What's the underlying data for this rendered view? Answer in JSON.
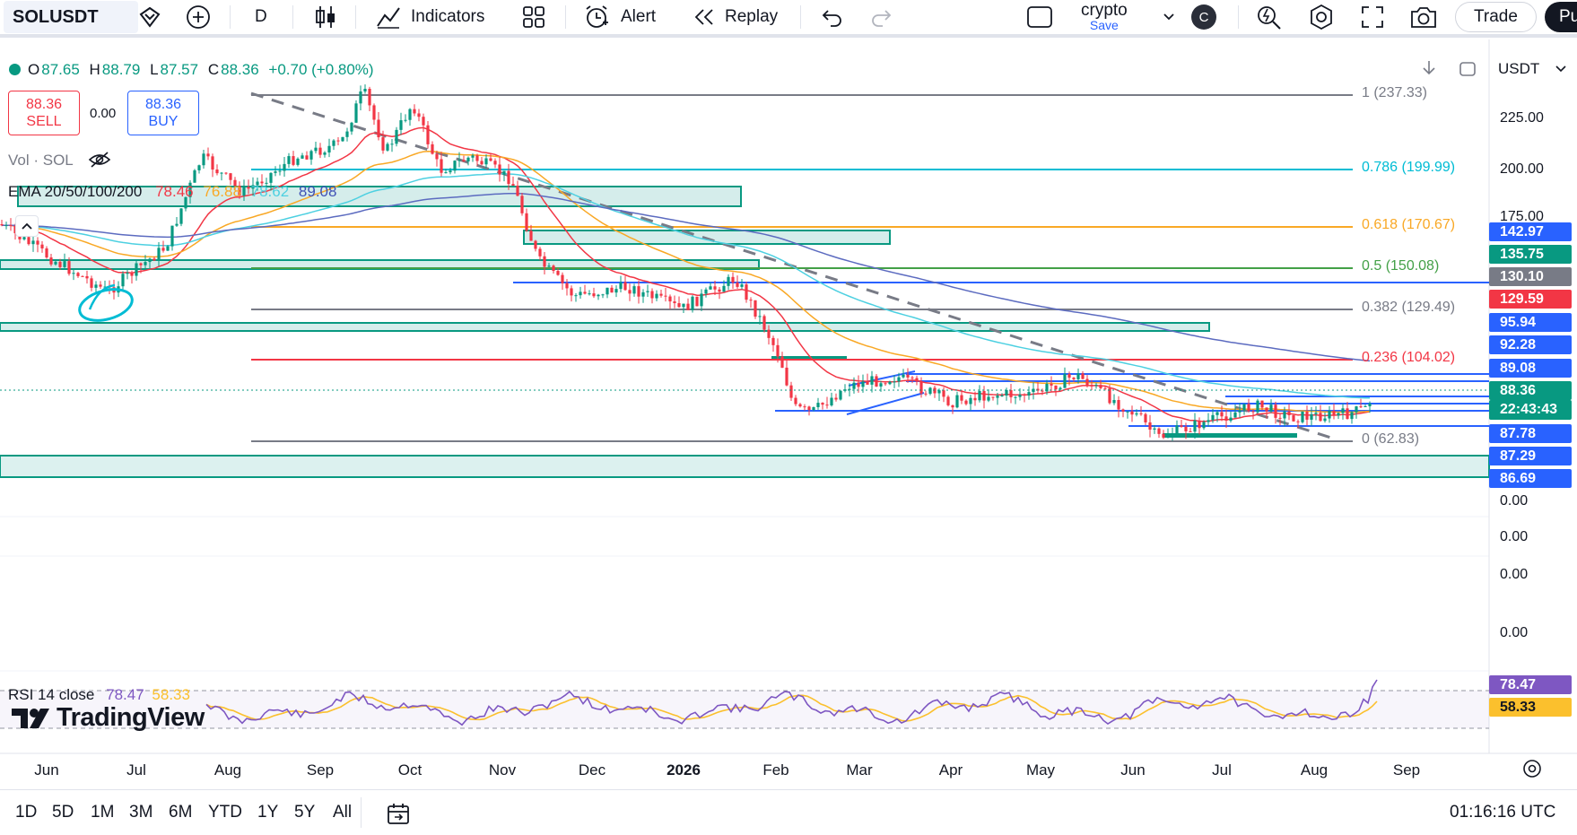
{
  "toolbar": {
    "symbol": "SOLUSDT",
    "interval": "D",
    "indicators_label": "Indicators",
    "alert_label": "Alert",
    "replay_label": "Replay",
    "layout_name": "crypto",
    "layout_save": "Save",
    "avatar_letter": "C",
    "trade_label": "Trade",
    "publish_label": "Pu"
  },
  "legend": {
    "open_label": "O",
    "open": "87.65",
    "high_label": "H",
    "high": "88.79",
    "low_label": "L",
    "low": "87.57",
    "close_label": "C",
    "close": "88.36",
    "change": "+0.70 (+0.80%)",
    "sell_price": "88.36",
    "sell_label": "SELL",
    "spread": "0.00",
    "buy_price": "88.36",
    "buy_label": "BUY",
    "vol_label": "Vol · SOL",
    "ema_label": "EMA 20/50/100/200",
    "ema_values": [
      "78.46",
      "76.88",
      "78.62",
      "89.08"
    ],
    "rsi_label": "RSI 14 close",
    "rsi_values": [
      "78.47",
      "58.33"
    ]
  },
  "currency": "USDT",
  "fib_levels": [
    {
      "label": "1 (237.33)",
      "color": "#787b86"
    },
    {
      "label": "0.786 (199.99)",
      "color": "#00bcd4"
    },
    {
      "label": "0.618 (170.67)",
      "color": "#f9a825"
    },
    {
      "label": "0.5 (150.08)",
      "color": "#43a047"
    },
    {
      "label": "0.382 (129.49)",
      "color": "#787b86"
    },
    {
      "label": "0.236 (104.02)",
      "color": "#f23645"
    },
    {
      "label": "0 (62.83)",
      "color": "#787b86"
    }
  ],
  "price_ticks": [
    "225.00",
    "200.00",
    "175.00"
  ],
  "indicator_ticks": [
    "0.00",
    "0.00",
    "0.00",
    "0.00"
  ],
  "price_labels": [
    {
      "text": "142.97",
      "color": "#2962ff"
    },
    {
      "text": "135.75",
      "color": "#089981"
    },
    {
      "text": "130.10",
      "color": "#787b86"
    },
    {
      "text": "129.59",
      "color": "#f23645"
    },
    {
      "text": "95.94",
      "color": "#2962ff"
    },
    {
      "text": "92.28",
      "color": "#2962ff"
    },
    {
      "text": "89.08",
      "color": "#2962ff"
    },
    {
      "text": "88.36",
      "color": "#089981"
    },
    {
      "text": "22:43:43",
      "color": "#089981"
    },
    {
      "text": "87.78",
      "color": "#2962ff"
    },
    {
      "text": "87.29",
      "color": "#2962ff"
    },
    {
      "text": "86.69",
      "color": "#2962ff"
    }
  ],
  "rsi_axis_labels": [
    {
      "text": "78.47",
      "color": "#7e57c2"
    },
    {
      "text": "58.33",
      "color": "#fbc02d"
    }
  ],
  "time_ticks": [
    "Jun",
    "Jul",
    "Aug",
    "Sep",
    "Oct",
    "Nov",
    "Dec",
    "2026",
    "Feb",
    "Mar",
    "Apr",
    "May",
    "Jun",
    "Jul",
    "Aug",
    "Sep"
  ],
  "ranges": [
    "1D",
    "5D",
    "1M",
    "3M",
    "6M",
    "YTD",
    "1Y",
    "5Y",
    "All"
  ],
  "clock": "01:16:16 UTC",
  "brand": "TradingView",
  "colors": {
    "up": "#089981",
    "down": "#f23645",
    "ema20": "#f23645",
    "ema50": "#f9a825",
    "ema100": "#4dd0e1",
    "ema200": "#5c6bc0",
    "rsi": "#7e57c2",
    "rsi_ma": "#fbc02d"
  }
}
